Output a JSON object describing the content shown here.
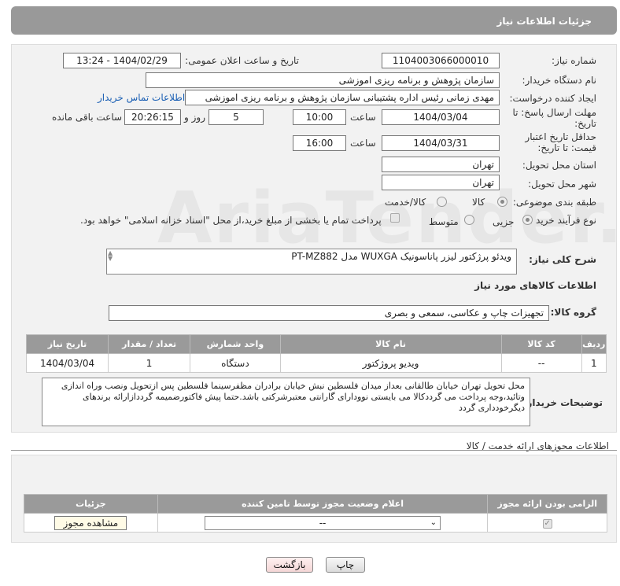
{
  "header": {
    "title": "جزئیات اطلاعات نیاز"
  },
  "form": {
    "need_number_label": "شماره نیاز:",
    "need_number": "1104003066000010",
    "announce_label": "تاریخ و ساعت اعلان عمومی:",
    "announce_value": "1404/02/29 - 13:24",
    "buyer_org_label": "نام دستگاه خریدار:",
    "buyer_org": "سازمان پژوهش و برنامه ریزی اموزشی",
    "creator_label": "ایجاد کننده درخواست:",
    "creator": "مهدی زمانی رئیس اداره پشتیبانی سازمان پژوهش و برنامه ریزی اموزشی",
    "contact_link": "اطلاعات تماس خریدار",
    "deadline_label": "مهلت ارسال پاسخ: تا تاریخ:",
    "deadline_date": "1404/03/04",
    "time_label": "ساعت",
    "deadline_time": "10:00",
    "days_value": "5",
    "days_label": "روز و",
    "remaining_time": "20:26:15",
    "remaining_label": "ساعت باقی مانده",
    "price_valid_label": "حداقل تاریخ اعتبار قیمت: تا تاریخ:",
    "price_valid_date": "1404/03/31",
    "price_valid_time": "16:00",
    "province_label": "استان محل تحویل:",
    "province": "تهران",
    "city_label": "شهر محل تحویل:",
    "city": "تهران",
    "category_label": "طبقه بندی موضوعی:",
    "category_goods": "کالا",
    "category_service": "کالا/خدمت",
    "process_label": "نوع فرآیند خرید :",
    "process_minor": "جزیی",
    "process_medium": "متوسط",
    "payment_note": "پرداخت تمام یا بخشی از مبلغ خرید،از محل \"اسناد خزانه اسلامی\" خواهد بود.",
    "description_label": "شرح کلی نیاز:",
    "description": "ویدئو پرژکتور لیزر پاناسونیک WUXGA مدل PT-MZ882",
    "goods_info_title": "اطلاعات کالاهای مورد نیاز",
    "goods_group_label": "گروه کالا:",
    "goods_group": "تجهیزات چاپ و عکاسی، سمعی و بصری"
  },
  "goods_table": {
    "headers": [
      "ردیف",
      "کد کالا",
      "نام کالا",
      "واحد شمارش",
      "تعداد / مقدار",
      "تاریخ نیاز"
    ],
    "rows": [
      [
        "1",
        "--",
        "ویدیو پروژکتور",
        "دستگاه",
        "1",
        "1404/03/04"
      ]
    ]
  },
  "buyer_notes": {
    "label": "توضیحات خریدار:",
    "text": "محل تحویل تهران خیابان طالقانی بعداز میدان فلسطین نبش خیابان برادران مظفرسینما فلسطین پس ازتحویل ونصب وراه اندازی وتائید،وجه پرداخت می گرددکالا می بایستی نوودارای گارانتی معتبرشرکتی باشد.حتما پیش فاکتورضمیمه گرددازارائه برندهای دیگرخودداری گردد"
  },
  "permits": {
    "title": "اطلاعات مجوزهای ارائه خدمت / کالا",
    "headers": [
      "الزامی بودن ارائه مجوز",
      "اعلام وضعیت مجوز توسط تامین کننده",
      "جزئیات"
    ],
    "select_value": "--",
    "view_button": "مشاهده مجوز"
  },
  "actions": {
    "print": "چاپ",
    "back": "بازگشت"
  },
  "watermark": "AriaTender.neT"
}
